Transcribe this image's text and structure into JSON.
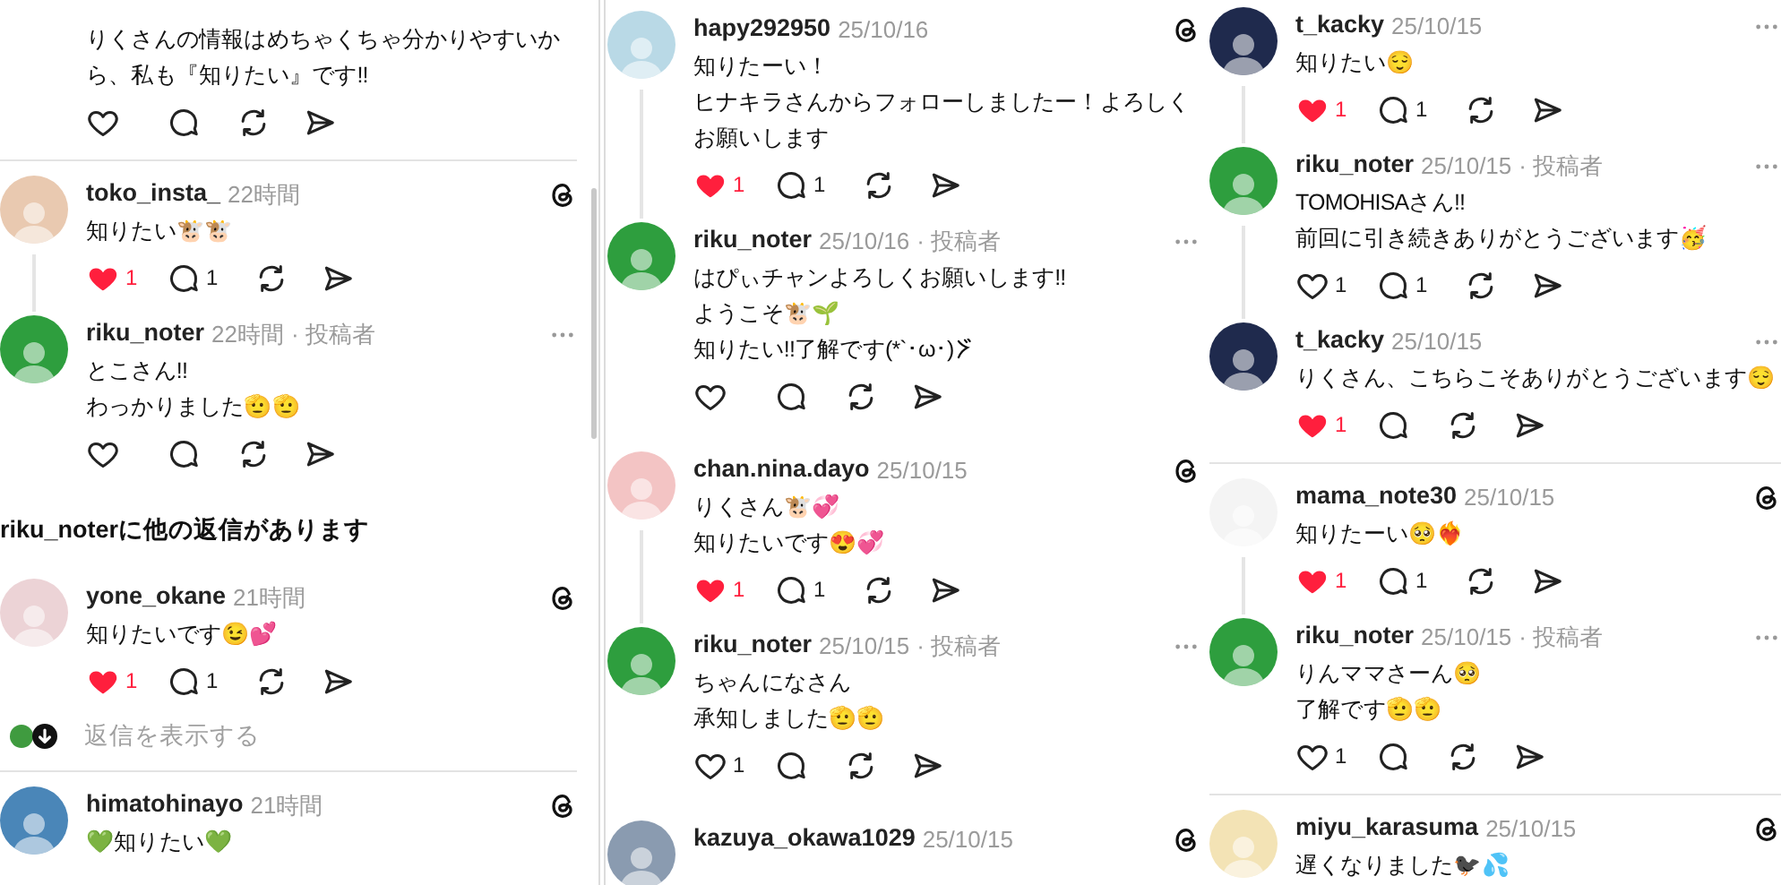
{
  "panels": [
    {
      "threads": [
        {
          "divider_above": false,
          "posts": [
            {
              "kind": "fragment",
              "lines": [
                "りくさんの情報はめちゃくちゃ分かりやすいか",
                "ら、私も『知りたい』です!!"
              ],
              "liked": false
            }
          ]
        },
        {
          "divider_above": true,
          "posts": [
            {
              "kind": "threads",
              "user": "toko_insta_",
              "time": "22時間",
              "color": "#e9c9b0",
              "lines": [
                "知りたい🐮🐮"
              ],
              "liked": true,
              "likes": "1",
              "replies": "1"
            },
            {
              "kind": "more",
              "user": "riku_noter",
              "time": "22時間",
              "role": "· 投稿者",
              "color": "#2e9e3e",
              "lines": [
                "とこさん!!",
                "わっかりました🫡🫡"
              ],
              "liked": false
            }
          ],
          "more_replies": "riku_noterに他の返信があります"
        },
        {
          "divider_above": false,
          "posts": [
            {
              "kind": "threads",
              "user": "yone_okane",
              "time": "21時間",
              "color": "#ecd3d6",
              "lines": [
                "知りたいです😉💕"
              ],
              "liked": true,
              "likes": "1",
              "replies": "1"
            }
          ],
          "show_replies": "返信を表示する"
        },
        {
          "divider_above": true,
          "posts": [
            {
              "kind": "threads",
              "user": "himatohinayo",
              "time": "21時間",
              "color": "#4a86b8",
              "lines": [
                "💚知りたい💚"
              ]
            }
          ]
        }
      ]
    },
    {
      "threads": [
        {
          "divider_above": false,
          "posts": [
            {
              "kind": "threads",
              "user": "hapy292950",
              "time": "25/10/16",
              "color": "#b9d9e6",
              "lines": [
                "知りたーい！",
                "ヒナキラさんからフォローしましたー！よろしく",
                "お願いします"
              ],
              "liked": true,
              "likes": "1",
              "replies": "1"
            },
            {
              "kind": "more",
              "user": "riku_noter",
              "time": "25/10/16",
              "role": "· 投稿者",
              "color": "#2e9e3e",
              "lines": [
                "はぴぃチャンよろしくお願いします!!",
                "ようこそ🐮🌱",
                "知りたい!!了解です(*`･ω･)"
              ],
              "wave_mark": true,
              "liked": false
            }
          ]
        },
        {
          "divider_above": false,
          "posts": [
            {
              "kind": "threads",
              "user": "chan.nina.dayo",
              "time": "25/10/15",
              "color": "#f3c4c4",
              "lines": [
                "りくさん🐮💞",
                "知りたいです😍💞"
              ],
              "liked": true,
              "likes": "1",
              "replies": "1"
            },
            {
              "kind": "more",
              "user": "riku_noter",
              "time": "25/10/15",
              "role": "· 投稿者",
              "color": "#2e9e3e",
              "lines": [
                "ちゃんになさん",
                "承知しました🫡🫡"
              ],
              "liked": false,
              "likes": "1"
            }
          ]
        },
        {
          "divider_above": false,
          "posts": [
            {
              "kind": "threads",
              "user": "kazuya_okawa1029",
              "time": "25/10/15",
              "color": "#8a9bb0"
            }
          ]
        }
      ]
    },
    {
      "threads": [
        {
          "divider_above": false,
          "posts": [
            {
              "kind": "more",
              "user": "t_kacky",
              "time": "25/10/15",
              "color": "#1f2a4d",
              "lines": [
                "知りたい😌"
              ],
              "liked": true,
              "likes": "1",
              "replies": "1"
            },
            {
              "kind": "more",
              "user": "riku_noter",
              "time": "25/10/15",
              "role": "· 投稿者",
              "color": "#2e9e3e",
              "lines": [
                "TOMOHISAさん!!",
                "前回に引き続きありがとうございます🥳"
              ],
              "liked": false,
              "likes": "1",
              "replies": "1"
            },
            {
              "kind": "more",
              "user": "t_kacky",
              "time": "25/10/15",
              "color": "#1f2a4d",
              "lines": [
                "りくさん、こちらこそありがとうございます😌"
              ],
              "liked": true,
              "likes": "1"
            }
          ]
        },
        {
          "divider_above": true,
          "posts": [
            {
              "kind": "threads",
              "user": "mama_note30",
              "time": "25/10/15",
              "color": "#f4f4f4",
              "lines": [
                "知りたーい🥺❤️‍🔥"
              ],
              "liked": true,
              "likes": "1",
              "replies": "1"
            },
            {
              "kind": "more",
              "user": "riku_noter",
              "time": "25/10/15",
              "role": "· 投稿者",
              "color": "#2e9e3e",
              "lines": [
                "りんママさーん🥺",
                "了解です🫡🫡"
              ],
              "liked": false,
              "likes": "1"
            }
          ]
        },
        {
          "divider_above": true,
          "posts": [
            {
              "kind": "threads",
              "user": "miyu_karasuma",
              "time": "25/10/15",
              "color": "#f3e3b5",
              "lines": [
                "遅くなりました🐦‍⬛💦"
              ]
            }
          ]
        }
      ]
    }
  ]
}
